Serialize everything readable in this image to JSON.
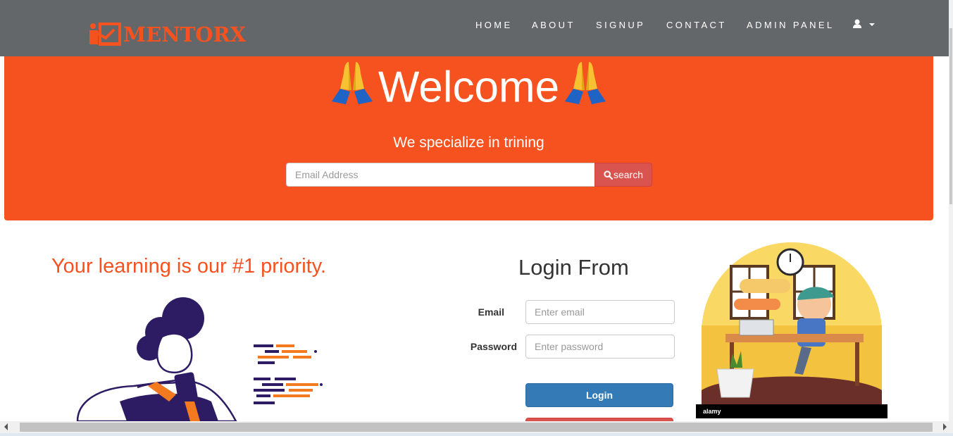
{
  "navbar": {
    "brand": "MENTORX",
    "links": [
      {
        "label": "HOME"
      },
      {
        "label": "ABOUT"
      },
      {
        "label": "SIGNUP"
      },
      {
        "label": "CONTACT"
      },
      {
        "label": "ADMIN PANEL"
      }
    ],
    "user_icon": "user-icon",
    "user_caret_icon": "caret-down-icon"
  },
  "hero": {
    "emoji_left": "folded-hands-icon",
    "welcome": "Welcome",
    "emoji_right": "folded-hands-icon",
    "tagline": "We specialize in trining",
    "search": {
      "placeholder": "Email Address",
      "value": "",
      "button_label": "search",
      "button_icon": "search-icon"
    }
  },
  "left": {
    "priority_heading": "Your learning is our #1 priority.",
    "illustration": "person-with-phone-illustration"
  },
  "login": {
    "title": "Login From",
    "email_label": "Email",
    "email_placeholder": "Enter email",
    "password_label": "Password",
    "password_placeholder": "Enter password",
    "login_button": "Login"
  },
  "right": {
    "illustration": "boy-studying-at-desk-illustration",
    "watermark": "alamy"
  },
  "colors": {
    "navbar": "#646769",
    "accent": "#f55220",
    "primary_button": "#337ab7",
    "danger_button": "#d9534f"
  }
}
